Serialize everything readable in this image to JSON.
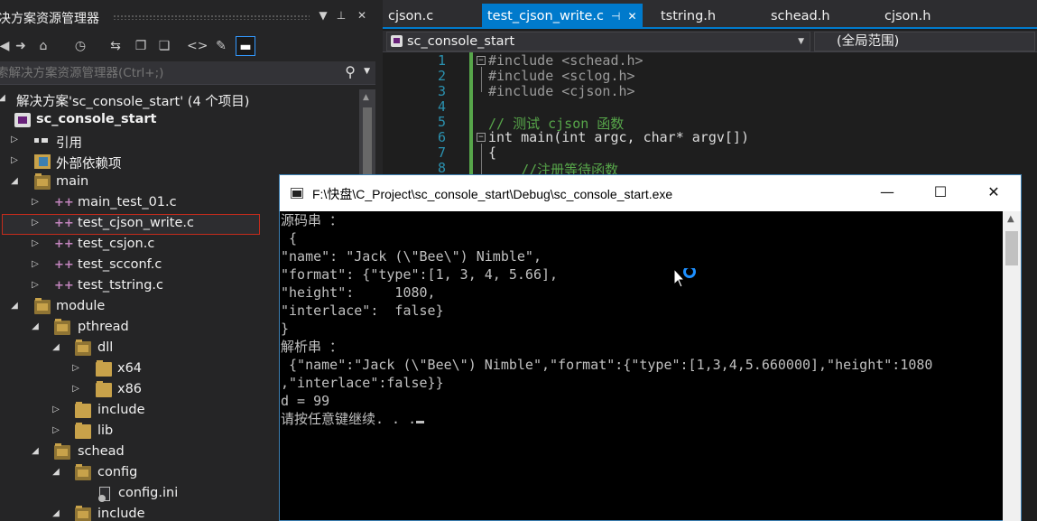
{
  "solution_explorer": {
    "title": "决方案资源管理器",
    "search_placeholder": "索解决方案资源管理器(Ctrl+;)",
    "toolbar_icons": [
      "back-icon",
      "forward-icon",
      "home-icon",
      "history-icon",
      "sync-icon",
      "collapse-icon",
      "copy-icon",
      "code-icon",
      "wrench-icon",
      "minimize-icon"
    ],
    "tree": [
      {
        "label": "解决方案'sc_console_start' (4 个项目)",
        "level": 0,
        "icon": "solution-icon",
        "expanded": true
      },
      {
        "label": "sc_console_start",
        "level": 1,
        "icon": "project-icon",
        "bold": true
      },
      {
        "label": "引用",
        "level": 1,
        "icon": "references-icon",
        "expanded": false
      },
      {
        "label": "外部依赖项",
        "level": 1,
        "icon": "external-deps-icon",
        "expanded": false
      },
      {
        "label": "main",
        "level": 1,
        "icon": "folder-icon",
        "expanded": true
      },
      {
        "label": "main_test_01.c",
        "level": 2,
        "icon": "c-file-icon"
      },
      {
        "label": "test_cjson_write.c",
        "level": 2,
        "icon": "c-file-icon",
        "selected": true
      },
      {
        "label": "test_csjon.c",
        "level": 2,
        "icon": "c-file-icon"
      },
      {
        "label": "test_scconf.c",
        "level": 2,
        "icon": "c-file-icon"
      },
      {
        "label": "test_tstring.c",
        "level": 2,
        "icon": "c-file-icon"
      },
      {
        "label": "module",
        "level": 1,
        "icon": "folder-icon",
        "expanded": true
      },
      {
        "label": "pthread",
        "level": 2,
        "icon": "folder-icon",
        "expanded": true
      },
      {
        "label": "dll",
        "level": 3,
        "icon": "folder-icon",
        "expanded": true
      },
      {
        "label": "x64",
        "level": 4,
        "icon": "folder-icon",
        "expanded": false
      },
      {
        "label": "x86",
        "level": 4,
        "icon": "folder-icon",
        "expanded": false
      },
      {
        "label": "include",
        "level": 3,
        "icon": "folder-icon",
        "expanded": false
      },
      {
        "label": "lib",
        "level": 3,
        "icon": "folder-icon",
        "expanded": false
      },
      {
        "label": "schead",
        "level": 2,
        "icon": "folder-icon",
        "expanded": true
      },
      {
        "label": "config",
        "level": 3,
        "icon": "folder-icon",
        "expanded": true
      },
      {
        "label": "config.ini",
        "level": 4,
        "icon": "ini-file-icon"
      },
      {
        "label": "include",
        "level": 3,
        "icon": "folder-icon",
        "expanded": true
      }
    ]
  },
  "editor": {
    "tabs": [
      {
        "label": "cjson.c",
        "active": false
      },
      {
        "label": "test_cjson_write.c",
        "active": true
      },
      {
        "label": "tstring.h",
        "active": false
      },
      {
        "label": "schead.h",
        "active": false
      },
      {
        "label": "cjson.h",
        "active": false
      }
    ],
    "nav_project": "sc_console_start",
    "nav_scope": "(全局范围)",
    "code_lines": [
      {
        "n": "1",
        "text": "#include <schead.h>"
      },
      {
        "n": "2",
        "text": "#include <sclog.h>"
      },
      {
        "n": "3",
        "text": "#include <cjson.h>"
      },
      {
        "n": "4",
        "text": ""
      },
      {
        "n": "5",
        "text": "// 测试 cjson 函数"
      },
      {
        "n": "6",
        "text": "int main(int argc, char* argv[])"
      },
      {
        "n": "7",
        "text": "{"
      },
      {
        "n": "8",
        "text": "    //注册等待函数"
      }
    ]
  },
  "console": {
    "title": "F:\\快盘\\C_Project\\sc_console_start\\Debug\\sc_console_start.exe",
    "lines": [
      "源码串 ：",
      " {",
      "\"name\": \"Jack (\\\"Bee\\\") Nimble\",",
      "\"format\": {\"type\":[1, 3, 4, 5.66],",
      "\"height\":     1080,",
      "\"interlace\":  false}",
      "}",
      "解析串 ：",
      " {\"name\":\"Jack (\\\"Bee\\\") Nimble\",\"format\":{\"type\":[1,3,4,5.660000],\"height\":1080",
      ",\"interlace\":false}}",
      "d = 99",
      "请按任意键继续. . ."
    ]
  },
  "colors": {
    "accent": "#007acc",
    "selection_outline": "#c42b1c",
    "keyword": "#569cd6",
    "comment": "#57a64a",
    "include_string": "#d69d85"
  }
}
